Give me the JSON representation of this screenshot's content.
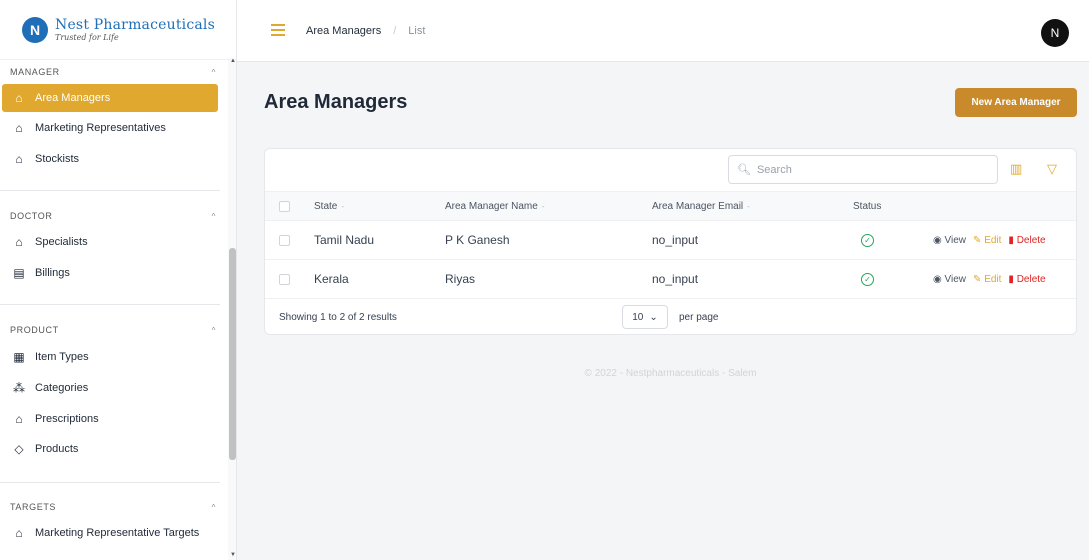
{
  "brand": {
    "name": "Nest Pharmaceuticals",
    "tagline": "Trusted for Life",
    "logo_letter": "N"
  },
  "sidebar": {
    "sections": [
      {
        "title": "MANAGER",
        "items": [
          {
            "label": "Area Managers",
            "icon": "folder-icon",
            "active": true
          },
          {
            "label": "Marketing Representatives",
            "icon": "folder-icon"
          },
          {
            "label": "Stockists",
            "icon": "folder-icon"
          }
        ]
      },
      {
        "title": "DOCTOR",
        "items": [
          {
            "label": "Specialists",
            "icon": "folder-icon"
          },
          {
            "label": "Billings",
            "icon": "receipt-icon"
          }
        ]
      },
      {
        "title": "PRODUCT",
        "items": [
          {
            "label": "Item Types",
            "icon": "grid-icon"
          },
          {
            "label": "Categories",
            "icon": "category-icon"
          },
          {
            "label": "Prescriptions",
            "icon": "folder-icon"
          },
          {
            "label": "Products",
            "icon": "tag-icon"
          }
        ]
      },
      {
        "title": "TARGETS",
        "items": [
          {
            "label": "Marketing Representative Targets",
            "icon": "folder-icon"
          }
        ]
      }
    ]
  },
  "topbar": {
    "breadcrumb": [
      "Area Managers",
      "List"
    ],
    "avatar": "N"
  },
  "main": {
    "title": "Area Managers",
    "new_button": "New Area Manager",
    "search_placeholder": "Search",
    "columns": [
      "State",
      "Area Manager Name",
      "Area Manager Email",
      "Status"
    ],
    "rows": [
      {
        "state": "Tamil Nadu",
        "name": "P K Ganesh",
        "email": "no_input",
        "status": "active"
      },
      {
        "state": "Kerala",
        "name": "Riyas",
        "email": "no_input",
        "status": "active"
      }
    ],
    "actions": {
      "view": "View",
      "edit": "Edit",
      "delete": "Delete"
    },
    "footer": {
      "showing": "Showing 1 to 2 of 2 results",
      "per_page_value": "10",
      "per_page_label": "per page"
    },
    "copyright": "© 2022 - Nestpharmaceuticals - Salem"
  },
  "colors": {
    "accent": "#e0a82e",
    "button": "#c98a2b",
    "success": "#22a55c",
    "danger": "#e02424"
  }
}
